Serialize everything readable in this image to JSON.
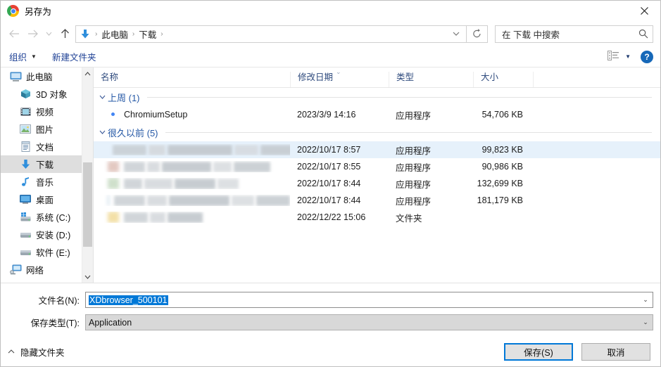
{
  "window": {
    "title": "另存为",
    "app_icon": "chrome-icon",
    "close_label": "✕"
  },
  "nav": {
    "back": "←",
    "forward": "→",
    "recent": "⌄",
    "up": "↑",
    "address": {
      "icon": "downloads-arrow-icon",
      "crumbs": [
        "此电脑",
        "下载"
      ],
      "separator": "›",
      "dropdown": "⌄"
    },
    "refresh": "↻",
    "search": {
      "text": "在 下载 中搜索",
      "icon": "search-icon"
    }
  },
  "commandbar": {
    "organize": "组织",
    "organize_caret": "▼",
    "new_folder": "新建文件夹",
    "view_icon": "list-view-icon",
    "view_caret": "▼",
    "help": "?"
  },
  "sidebar": {
    "items": [
      {
        "label": "此电脑",
        "icon": "computer-icon",
        "indent": false,
        "selected": false
      },
      {
        "label": "3D 对象",
        "icon": "3d-objects-icon",
        "indent": true,
        "selected": false
      },
      {
        "label": "视频",
        "icon": "videos-icon",
        "indent": true,
        "selected": false
      },
      {
        "label": "图片",
        "icon": "pictures-icon",
        "indent": true,
        "selected": false
      },
      {
        "label": "文档",
        "icon": "documents-icon",
        "indent": true,
        "selected": false
      },
      {
        "label": "下载",
        "icon": "downloads-icon",
        "indent": true,
        "selected": true
      },
      {
        "label": "音乐",
        "icon": "music-icon",
        "indent": true,
        "selected": false
      },
      {
        "label": "桌面",
        "icon": "desktop-icon",
        "indent": true,
        "selected": false
      },
      {
        "label": "系统 (C:)",
        "icon": "windows-drive-icon",
        "indent": true,
        "selected": false
      },
      {
        "label": "安装 (D:)",
        "icon": "drive-icon",
        "indent": true,
        "selected": false
      },
      {
        "label": "软件 (E:)",
        "icon": "drive-icon",
        "indent": true,
        "selected": false
      },
      {
        "label": "网络",
        "icon": "network-icon",
        "indent": false,
        "selected": false
      }
    ],
    "scroll_up": "⌃",
    "scroll_down": "⌄"
  },
  "filelist": {
    "columns": {
      "name": "名称",
      "date": "修改日期",
      "type": "类型",
      "size": "大小",
      "sort_indicator": "⌄"
    },
    "groups": [
      {
        "label": "上周 (1)",
        "chevron": "⌄",
        "rows": [
          {
            "name": "ChromiumSetup",
            "icon": "chrome-icon",
            "redacted": false,
            "date": "2023/3/9 14:16",
            "type": "应用程序",
            "size": "54,706 KB",
            "selected": false
          }
        ]
      },
      {
        "label": "很久以前 (5)",
        "chevron": "⌄",
        "rows": [
          {
            "name": "",
            "icon": "redacted-icon",
            "redacted": true,
            "date": "2022/10/17 8:57",
            "type": "应用程序",
            "size": "99,823 KB",
            "selected": true
          },
          {
            "name": "",
            "icon": "redacted-icon",
            "redacted": true,
            "date": "2022/10/17 8:55",
            "type": "应用程序",
            "size": "90,986 KB",
            "selected": false
          },
          {
            "name": "",
            "icon": "redacted-icon",
            "redacted": true,
            "date": "2022/10/17 8:44",
            "type": "应用程序",
            "size": "132,699 KB",
            "selected": false
          },
          {
            "name": "",
            "icon": "redacted-icon",
            "redacted": true,
            "date": "2022/10/17 8:44",
            "type": "应用程序",
            "size": "181,179 KB",
            "selected": false
          },
          {
            "name": "",
            "icon": "redacted-folder-icon",
            "redacted": true,
            "date": "2022/12/22 15:06",
            "type": "文件夹",
            "size": "",
            "selected": false
          }
        ]
      }
    ]
  },
  "form": {
    "filename_label": "文件名(N):",
    "filename_value": "XDbrowser_500101",
    "filetype_label": "保存类型(T):",
    "filetype_value": "Application",
    "dropdown_caret": "⌄"
  },
  "footer": {
    "hide_folders": "隐藏文件夹",
    "hide_chevron": "⌃",
    "save": "保存(S)",
    "cancel": "取消"
  },
  "colors": {
    "accent": "#0078d7",
    "link": "#2558a6",
    "selection_row": "#e6f1fb",
    "sidebar_selected": "#dedede"
  }
}
